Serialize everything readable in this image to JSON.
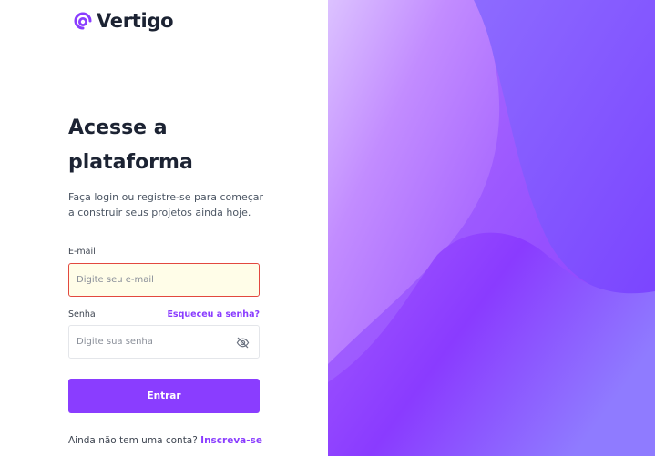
{
  "brand": {
    "name": "Vertigo",
    "icon": "vertigo-logo-icon"
  },
  "login": {
    "title": "Acesse a plataforma",
    "subtitle": "Faça login ou registre-se para começar a construir seus projetos ainda hoje.",
    "email": {
      "label": "E-mail",
      "placeholder": "Digite seu e-mail",
      "value": ""
    },
    "password": {
      "label": "Senha",
      "placeholder": "Digite sua senha",
      "value": "",
      "toggle_icon": "eye-off-icon"
    },
    "forgot_label": "Esqueceu a senha?",
    "submit_label": "Entrar",
    "signup_prompt": "Ainda não tem uma conta?",
    "signup_label": "Inscreva-se"
  },
  "colors": {
    "accent": "#8a3dff",
    "text_dark": "#1c2333",
    "error_border": "#e2483f",
    "error_fill": "#fffde8"
  }
}
